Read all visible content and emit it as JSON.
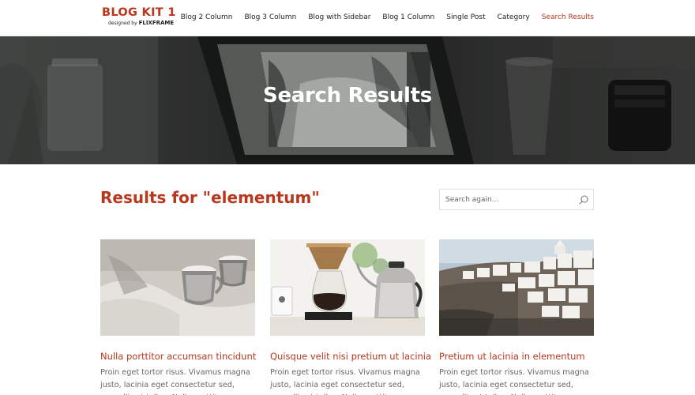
{
  "header": {
    "logo_title": "BLOG KIT 1",
    "logo_sub_prefix": "designed by",
    "logo_sub_brand": "FLIXFRAME",
    "nav": [
      {
        "label": "Blog 2 Column"
      },
      {
        "label": "Blog 3 Column"
      },
      {
        "label": "Blog with Sidebar"
      },
      {
        "label": "Blog 1 Column"
      },
      {
        "label": "Single Post"
      },
      {
        "label": "Category"
      },
      {
        "label": "Search Results",
        "active": true
      }
    ]
  },
  "hero": {
    "title": "Search Results",
    "image": "laptop-desk-photo"
  },
  "results": {
    "heading": "Results for \"elementum\""
  },
  "search": {
    "placeholder": "Search again...",
    "icon": "search-icon"
  },
  "cards": [
    {
      "image": "coffee-cups-photo",
      "title": "Nulla porttitor accumsan tincidunt",
      "excerpt": "Proin eget tortor risus. Vivamus magna justo, lacinia eget consectetur sed, convallis at tellus. Nulla porttitor"
    },
    {
      "image": "coffee-pourover-photo",
      "title": "Quisque velit nisi pretium ut lacinia",
      "excerpt": "Proin eget tortor risus. Vivamus magna justo, lacinia eget consectetur sed, convallis at tellus. Nulla porttitor"
    },
    {
      "image": "santorini-village-photo",
      "title": "Pretium ut lacinia in elementum",
      "excerpt": "Proin eget tortor risus. Vivamus magna justo, lacinia eget consectetur sed, convallis at tellus. Nulla porttitor"
    }
  ],
  "colors": {
    "accent": "#b8371d",
    "text": "#666666",
    "nav_text": "#222222"
  }
}
